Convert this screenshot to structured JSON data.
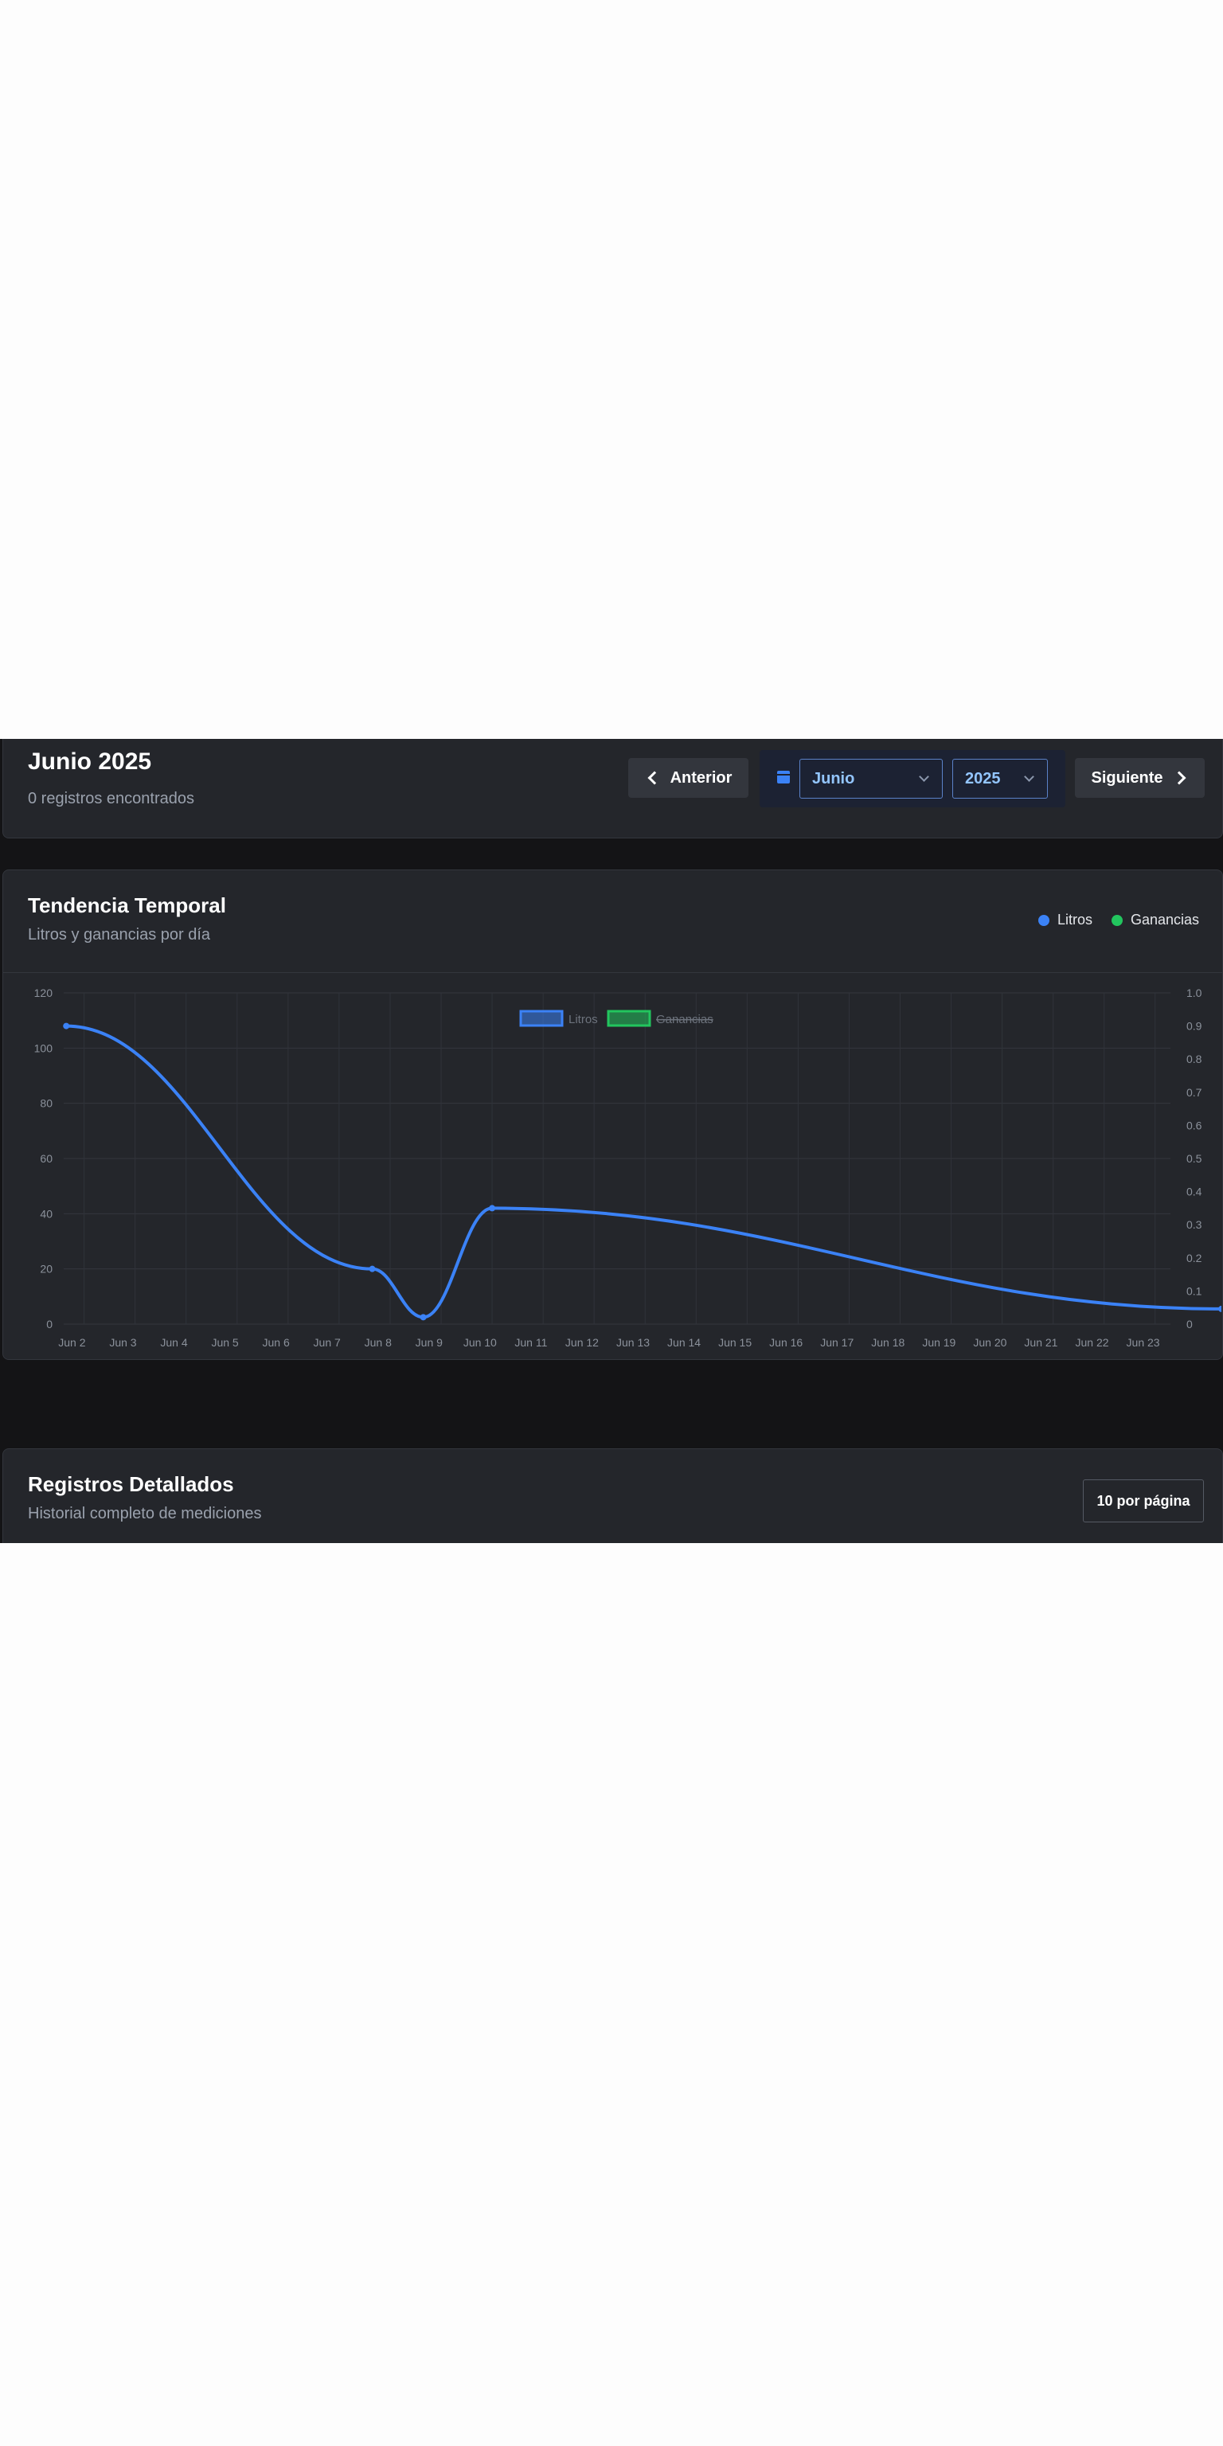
{
  "header": {
    "title": "Junio 2025",
    "records_text": "0 registros encontrados",
    "prev_label": "Anterior",
    "next_label": "Siguiente",
    "month_value": "Junio",
    "year_value": "2025"
  },
  "chart_card": {
    "title": "Tendencia Temporal",
    "subtitle": "Litros y ganancias por día",
    "legend": [
      {
        "label": "Litros",
        "color": "#3b82f6"
      },
      {
        "label": "Ganancias",
        "color": "#22c55e"
      }
    ]
  },
  "chart_data": {
    "type": "line",
    "legend": [
      {
        "name": "Litros",
        "color": "#3b82f6",
        "hidden": false
      },
      {
        "name": "Ganancias",
        "color": "#22c55e",
        "hidden": true
      }
    ],
    "x_labels": [
      "Jun 2",
      "Jun 3",
      "Jun 4",
      "Jun 5",
      "Jun 6",
      "Jun 7",
      "Jun 8",
      "Jun 9",
      "Jun 10",
      "Jun 11",
      "Jun 12",
      "Jun 13",
      "Jun 14",
      "Jun 15",
      "Jun 16",
      "Jun 17",
      "Jun 18",
      "Jun 19",
      "Jun 20",
      "Jun 21",
      "Jun 22",
      "Jun 23"
    ],
    "y_left": {
      "min": 0,
      "max": 120,
      "ticks": [
        "0",
        "20",
        "40",
        "60",
        "80",
        "100",
        "120"
      ]
    },
    "y_right": {
      "min": 0,
      "max": 1,
      "ticks": [
        "0",
        "0.1",
        "0.2",
        "0.3",
        "0.4",
        "0.5",
        "0.6",
        "0.7",
        "0.8",
        "0.9",
        "1.0"
      ]
    },
    "series": [
      {
        "name": "Litros",
        "color": "#3b82f6",
        "points": [
          {
            "x": 1.55,
            "y": 108
          },
          {
            "x": 7.55,
            "y": 20
          },
          {
            "x": 8.55,
            "y": 2.5
          },
          {
            "x": 9.9,
            "y": 42
          },
          {
            "x": 24.2,
            "y": 5.5
          }
        ]
      }
    ],
    "grid": true
  },
  "records_card": {
    "title": "Registros Detallados",
    "subtitle": "Historial completo de mediciones",
    "per_page_label": "10 por página"
  }
}
